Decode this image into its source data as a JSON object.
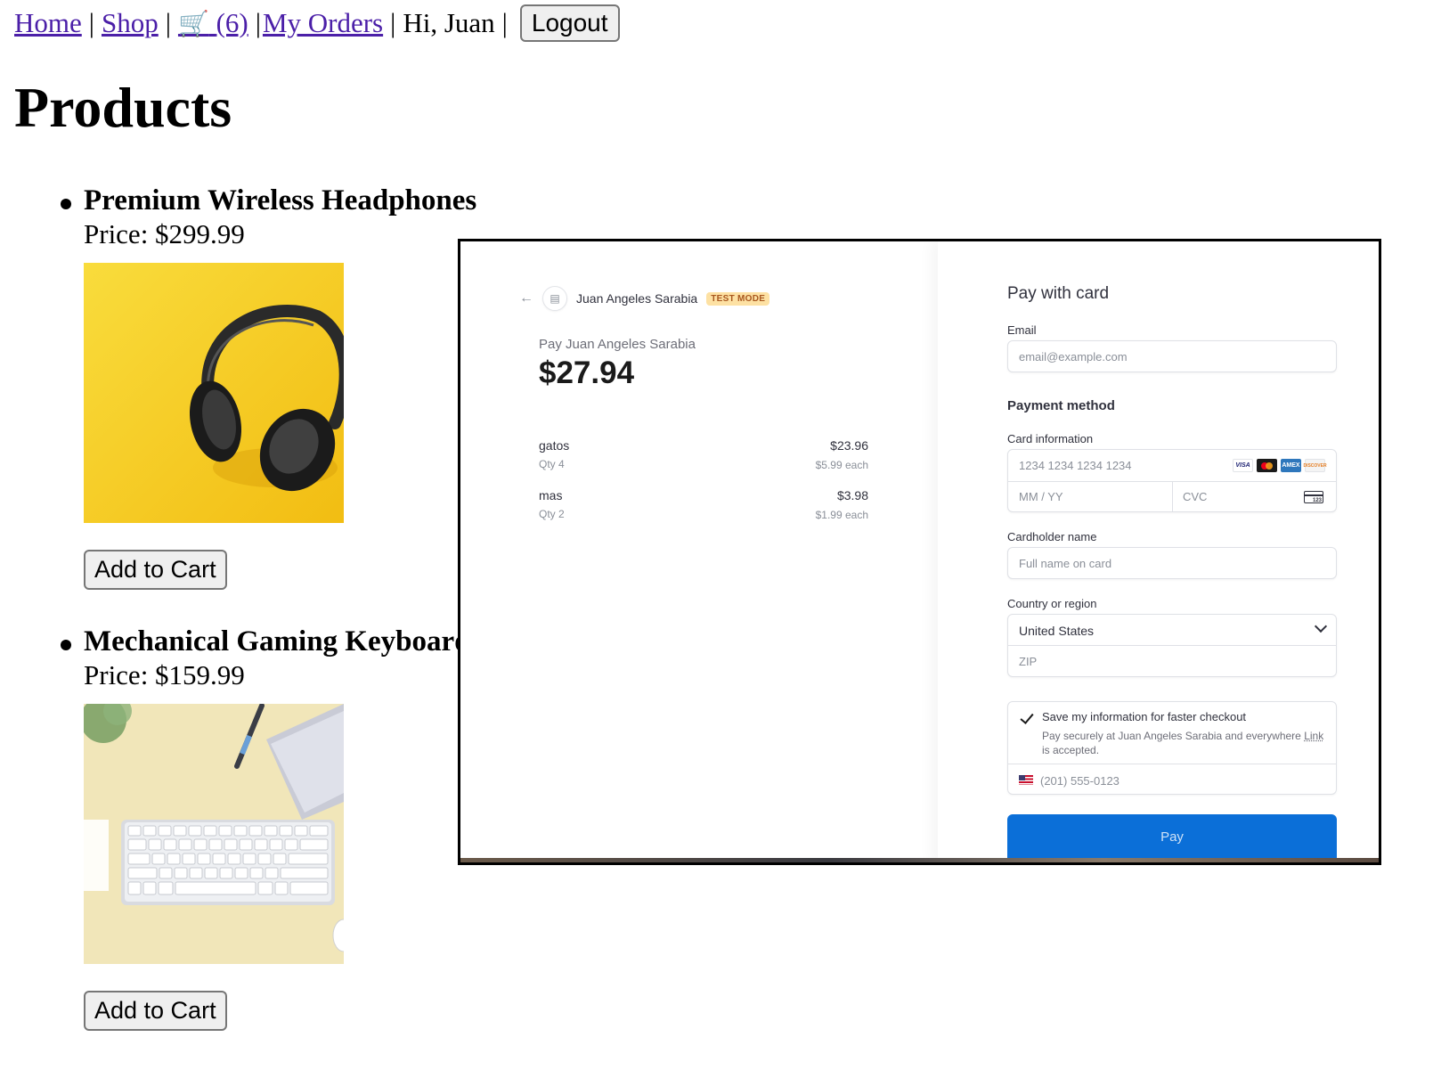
{
  "nav": {
    "home": "Home",
    "shop": "Shop",
    "cart_icon": "🛒",
    "cart_count": "(6)",
    "my_orders": "My Orders",
    "greeting": "Hi, Juan",
    "logout": "Logout",
    "separator": "|"
  },
  "page": {
    "title": "Products"
  },
  "products": [
    {
      "name": "Premium Wireless Headphones",
      "price": "Price: $299.99",
      "add_label": "Add to Cart",
      "image": "headphones-on-yellow"
    },
    {
      "name": "Mechanical Gaming Keyboard",
      "price": "Price: $159.99",
      "add_label": "Add to Cart",
      "image": "keyboard-on-desk"
    }
  ],
  "checkout": {
    "merchant": "Juan Angeles Sarabia",
    "test_badge": "TEST MODE",
    "pay_to": "Pay Juan Angeles Sarabia",
    "amount": "$27.94",
    "items": [
      {
        "name": "gatos",
        "qty": "Qty 4",
        "total": "$23.96",
        "each": "$5.99 each"
      },
      {
        "name": "mas",
        "qty": "Qty 2",
        "total": "$3.98",
        "each": "$1.99 each"
      }
    ],
    "form": {
      "title": "Pay with card",
      "email_label": "Email",
      "email_placeholder": "email@example.com",
      "payment_method": "Payment method",
      "card_info_label": "Card information",
      "card_number_placeholder": "1234 1234 1234 1234",
      "expiry_placeholder": "MM / YY",
      "cvc_placeholder": "CVC",
      "cvc_icon_text": "123",
      "brands": [
        "VISA",
        "",
        "AMEX",
        "DISCOVER"
      ],
      "cardholder_label": "Cardholder name",
      "cardholder_placeholder": "Full name on card",
      "country_label": "Country or region",
      "country_value": "United States",
      "zip_placeholder": "ZIP",
      "save_title": "Save my information for faster checkout",
      "save_desc_prefix": "Pay securely at Juan Angeles Sarabia and everywhere",
      "save_desc_link": "Link",
      "save_desc_suffix": "is accepted.",
      "phone_placeholder": "(201) 555-0123",
      "pay_label": "Pay"
    }
  }
}
